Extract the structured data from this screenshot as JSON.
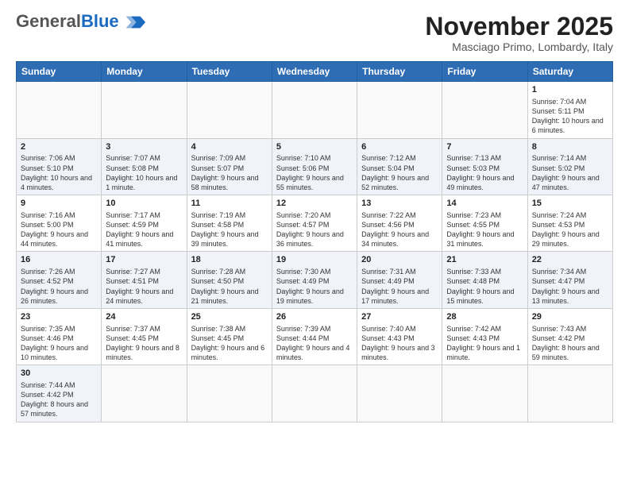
{
  "header": {
    "logo_general": "General",
    "logo_blue": "Blue",
    "month_title": "November 2025",
    "location": "Masciago Primo, Lombardy, Italy"
  },
  "weekdays": [
    "Sunday",
    "Monday",
    "Tuesday",
    "Wednesday",
    "Thursday",
    "Friday",
    "Saturday"
  ],
  "weeks": [
    [
      {
        "day": "",
        "info": ""
      },
      {
        "day": "",
        "info": ""
      },
      {
        "day": "",
        "info": ""
      },
      {
        "day": "",
        "info": ""
      },
      {
        "day": "",
        "info": ""
      },
      {
        "day": "",
        "info": ""
      },
      {
        "day": "1",
        "info": "Sunrise: 7:04 AM\nSunset: 5:11 PM\nDaylight: 10 hours and 6 minutes."
      }
    ],
    [
      {
        "day": "2",
        "info": "Sunrise: 7:06 AM\nSunset: 5:10 PM\nDaylight: 10 hours and 4 minutes."
      },
      {
        "day": "3",
        "info": "Sunrise: 7:07 AM\nSunset: 5:08 PM\nDaylight: 10 hours and 1 minute."
      },
      {
        "day": "4",
        "info": "Sunrise: 7:09 AM\nSunset: 5:07 PM\nDaylight: 9 hours and 58 minutes."
      },
      {
        "day": "5",
        "info": "Sunrise: 7:10 AM\nSunset: 5:06 PM\nDaylight: 9 hours and 55 minutes."
      },
      {
        "day": "6",
        "info": "Sunrise: 7:12 AM\nSunset: 5:04 PM\nDaylight: 9 hours and 52 minutes."
      },
      {
        "day": "7",
        "info": "Sunrise: 7:13 AM\nSunset: 5:03 PM\nDaylight: 9 hours and 49 minutes."
      },
      {
        "day": "8",
        "info": "Sunrise: 7:14 AM\nSunset: 5:02 PM\nDaylight: 9 hours and 47 minutes."
      }
    ],
    [
      {
        "day": "9",
        "info": "Sunrise: 7:16 AM\nSunset: 5:00 PM\nDaylight: 9 hours and 44 minutes."
      },
      {
        "day": "10",
        "info": "Sunrise: 7:17 AM\nSunset: 4:59 PM\nDaylight: 9 hours and 41 minutes."
      },
      {
        "day": "11",
        "info": "Sunrise: 7:19 AM\nSunset: 4:58 PM\nDaylight: 9 hours and 39 minutes."
      },
      {
        "day": "12",
        "info": "Sunrise: 7:20 AM\nSunset: 4:57 PM\nDaylight: 9 hours and 36 minutes."
      },
      {
        "day": "13",
        "info": "Sunrise: 7:22 AM\nSunset: 4:56 PM\nDaylight: 9 hours and 34 minutes."
      },
      {
        "day": "14",
        "info": "Sunrise: 7:23 AM\nSunset: 4:55 PM\nDaylight: 9 hours and 31 minutes."
      },
      {
        "day": "15",
        "info": "Sunrise: 7:24 AM\nSunset: 4:53 PM\nDaylight: 9 hours and 29 minutes."
      }
    ],
    [
      {
        "day": "16",
        "info": "Sunrise: 7:26 AM\nSunset: 4:52 PM\nDaylight: 9 hours and 26 minutes."
      },
      {
        "day": "17",
        "info": "Sunrise: 7:27 AM\nSunset: 4:51 PM\nDaylight: 9 hours and 24 minutes."
      },
      {
        "day": "18",
        "info": "Sunrise: 7:28 AM\nSunset: 4:50 PM\nDaylight: 9 hours and 21 minutes."
      },
      {
        "day": "19",
        "info": "Sunrise: 7:30 AM\nSunset: 4:49 PM\nDaylight: 9 hours and 19 minutes."
      },
      {
        "day": "20",
        "info": "Sunrise: 7:31 AM\nSunset: 4:49 PM\nDaylight: 9 hours and 17 minutes."
      },
      {
        "day": "21",
        "info": "Sunrise: 7:33 AM\nSunset: 4:48 PM\nDaylight: 9 hours and 15 minutes."
      },
      {
        "day": "22",
        "info": "Sunrise: 7:34 AM\nSunset: 4:47 PM\nDaylight: 9 hours and 13 minutes."
      }
    ],
    [
      {
        "day": "23",
        "info": "Sunrise: 7:35 AM\nSunset: 4:46 PM\nDaylight: 9 hours and 10 minutes."
      },
      {
        "day": "24",
        "info": "Sunrise: 7:37 AM\nSunset: 4:45 PM\nDaylight: 9 hours and 8 minutes."
      },
      {
        "day": "25",
        "info": "Sunrise: 7:38 AM\nSunset: 4:45 PM\nDaylight: 9 hours and 6 minutes."
      },
      {
        "day": "26",
        "info": "Sunrise: 7:39 AM\nSunset: 4:44 PM\nDaylight: 9 hours and 4 minutes."
      },
      {
        "day": "27",
        "info": "Sunrise: 7:40 AM\nSunset: 4:43 PM\nDaylight: 9 hours and 3 minutes."
      },
      {
        "day": "28",
        "info": "Sunrise: 7:42 AM\nSunset: 4:43 PM\nDaylight: 9 hours and 1 minute."
      },
      {
        "day": "29",
        "info": "Sunrise: 7:43 AM\nSunset: 4:42 PM\nDaylight: 8 hours and 59 minutes."
      }
    ],
    [
      {
        "day": "30",
        "info": "Sunrise: 7:44 AM\nSunset: 4:42 PM\nDaylight: 8 hours and 57 minutes."
      },
      {
        "day": "",
        "info": ""
      },
      {
        "day": "",
        "info": ""
      },
      {
        "day": "",
        "info": ""
      },
      {
        "day": "",
        "info": ""
      },
      {
        "day": "",
        "info": ""
      },
      {
        "day": "",
        "info": ""
      }
    ]
  ]
}
